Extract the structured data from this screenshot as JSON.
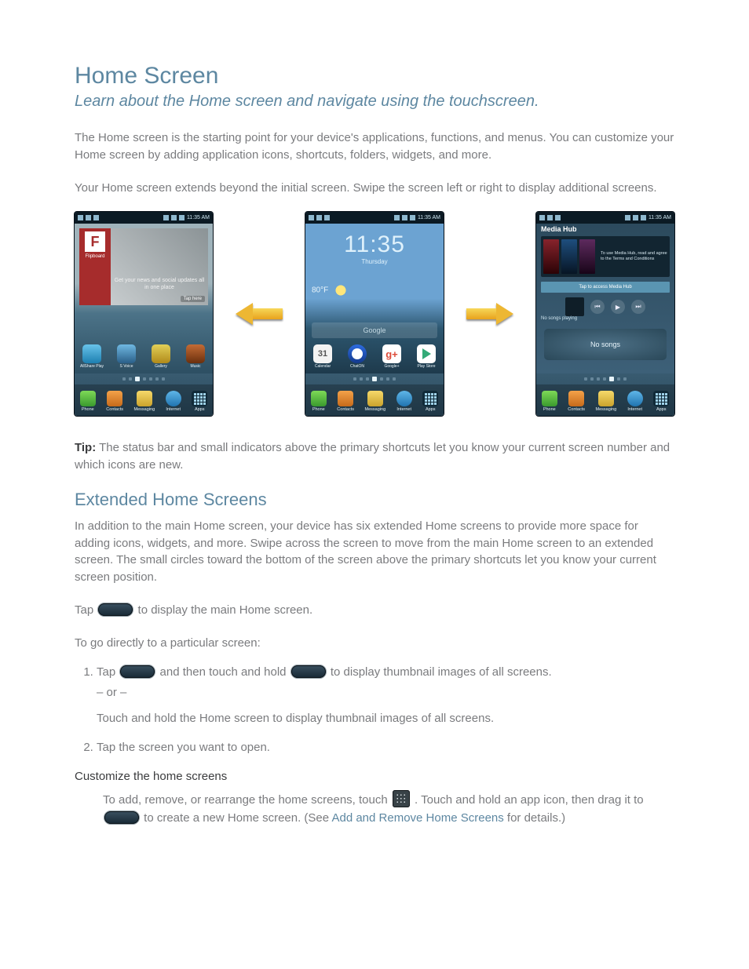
{
  "section": {
    "title": "Home Screen",
    "subtitle": "Learn about the Home screen and navigate using the touchscreen.",
    "intro1": "The Home screen is the starting point for your device's applications, functions, and menus. You can customize your Home screen by adding application icons, shortcuts, folders, widgets, and more.",
    "screens_hint": "Your Home screen extends beyond the initial screen. Swipe the screen left or right to display additional screens."
  },
  "phones": {
    "status_time": "11:35 AM",
    "dock": {
      "phone": "Phone",
      "contacts": "Contacts",
      "messaging": "Messaging",
      "internet": "Internet",
      "apps": "Apps"
    },
    "left": {
      "flip_brand": "F",
      "flip_brand_label": "Flipboard",
      "flip_caption": "Get your news and social updates all in one place",
      "flip_cta": "Tap here",
      "apps": [
        "AllShare Play",
        "S Voice",
        "Gallery",
        "Music"
      ]
    },
    "center": {
      "clock_time": "11:35",
      "clock_day": "Thursday",
      "weather_temp": "80°F",
      "search_label": "Google",
      "cal_day": "31",
      "apps": [
        "Calendar",
        "ChatON",
        "Google+",
        "Play Store"
      ]
    },
    "right": {
      "media_hub_title": "Media Hub",
      "media_hub_note": "To use Media Hub, read and agree to the Terms and Conditions",
      "accent_bar": "Tap to access Media Hub",
      "no_songs_playing": "No songs playing",
      "no_songs": "No songs"
    }
  },
  "tip": {
    "label": "Tip:",
    "text": "The status bar and small indicators above the primary shortcuts let you know your current screen number and which icons are new."
  },
  "ext": {
    "heading": "Extended Home Screens",
    "p1": "In addition to the main Home screen, your device has six extended Home screens to provide more space for adding icons, widgets, and more. Swipe across the screen to move from the main Home screen to an extended screen. The small circles toward the bottom of the screen above the primary shortcuts let you know your current screen position.",
    "p2_pre": "Tap ",
    "p2_post": " to display the main Home screen.",
    "p3": "To go directly to a particular screen:"
  },
  "steps": {
    "s1_pre": "Tap ",
    "s1_mid": " and then touch and hold ",
    "s1_post": " to display thumbnail images of all screens.",
    "s1_or": "– or –",
    "s1_alt": "Touch and hold the Home screen to display thumbnail images of all screens.",
    "s2": "Tap the screen you want to open.",
    "custom_head": "Customize the home screens",
    "custom_p_pre": "To add, remove, or rearrange the home screens, touch ",
    "custom_p_mid": ". Touch and hold an app icon, then drag it to ",
    "custom_p_post": " to create a new Home screen. (See ",
    "custom_link": "Add and Remove Home Screens",
    "custom_tail": " for details.)"
  }
}
